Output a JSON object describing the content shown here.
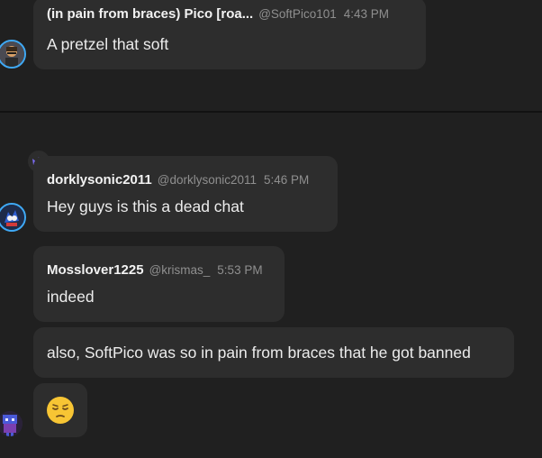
{
  "messages": [
    {
      "name": "(in pain from braces) Pico [roa...",
      "handle": "@SoftPico101",
      "time": "4:43 PM",
      "text": "A pretzel that soft"
    },
    {
      "name": "dorklysonic2011",
      "handle": "@dorklysonic2011",
      "time": "5:46 PM",
      "text": "Hey guys is this a dead chat"
    },
    {
      "name": "Mosslover1225",
      "handle": "@krismas_",
      "time": "5:53 PM",
      "text": "indeed"
    }
  ],
  "followups": [
    {
      "text": "also, SoftPico was so in pain from braces that he got banned"
    },
    {
      "emoji": "😔"
    }
  ],
  "icons": {
    "crown": "crown-icon"
  },
  "colors": {
    "background": "#202020",
    "bubble": "#2d2d2d",
    "accent_crown": "#7b6cf2",
    "ring_blue": "#3fa9f5"
  }
}
